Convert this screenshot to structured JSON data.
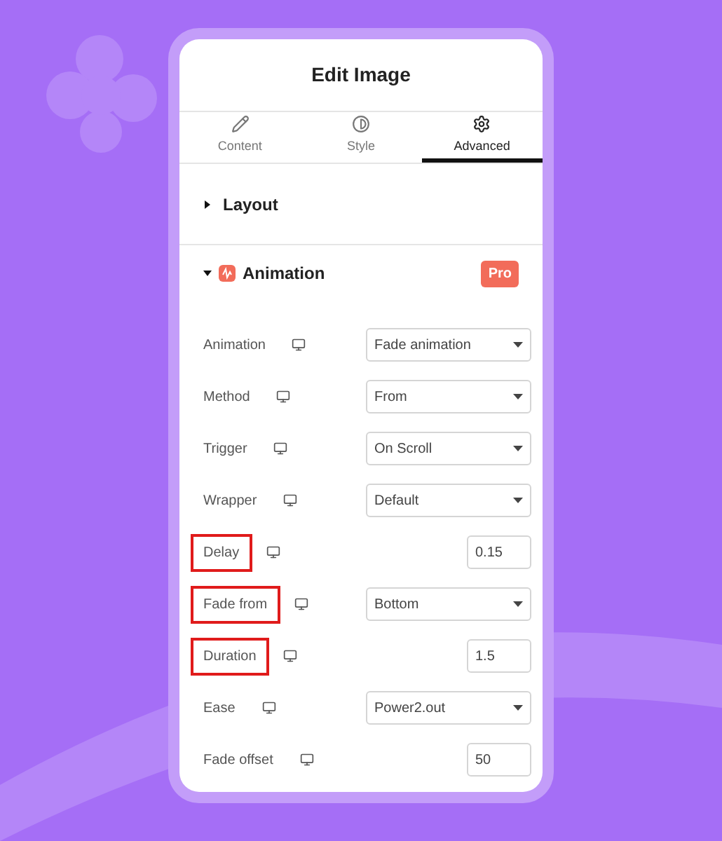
{
  "panel": {
    "title": "Edit Image"
  },
  "tabs": [
    {
      "label": "Content",
      "kind": "pencil",
      "selected": false
    },
    {
      "label": "Style",
      "kind": "contrast",
      "selected": false
    },
    {
      "label": "Advanced",
      "kind": "gear",
      "selected": true
    }
  ],
  "sections": [
    {
      "title": "Layout",
      "expanded": false
    },
    {
      "title": "Animation",
      "expanded": true,
      "badge": "Pro"
    }
  ],
  "fields": [
    {
      "label": "Animation",
      "kind": "select",
      "value": "Fade animation",
      "highlighted": false
    },
    {
      "label": "Method",
      "kind": "select",
      "value": "From",
      "highlighted": false
    },
    {
      "label": "Trigger",
      "kind": "select",
      "value": "On Scroll",
      "highlighted": false
    },
    {
      "label": "Wrapper",
      "kind": "select",
      "value": "Default",
      "highlighted": false
    },
    {
      "label": "Delay",
      "kind": "number",
      "value": "0.15",
      "highlighted": true
    },
    {
      "label": "Fade from",
      "kind": "select",
      "value": "Bottom",
      "highlighted": true
    },
    {
      "label": "Duration",
      "kind": "number",
      "value": "1.5",
      "highlighted": true
    },
    {
      "label": "Ease",
      "kind": "select",
      "value": "Power2.out",
      "highlighted": false
    },
    {
      "label": "Fade offset",
      "kind": "number",
      "value": "50",
      "highlighted": false
    }
  ]
}
